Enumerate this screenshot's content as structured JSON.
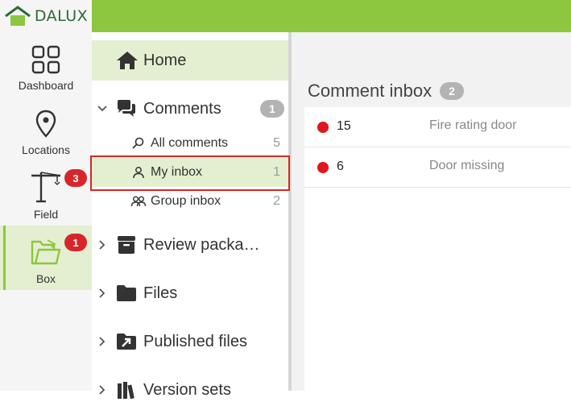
{
  "brand": {
    "name": "DALUX",
    "accent": "#8dc63f",
    "logo_icon": "house-icon"
  },
  "rail": [
    {
      "label": "Dashboard",
      "icon": "grid-icon",
      "badge": null
    },
    {
      "label": "Locations",
      "icon": "map-pin-icon",
      "badge": null
    },
    {
      "label": "Field",
      "icon": "crane-icon",
      "badge": "3"
    },
    {
      "label": "Box",
      "icon": "open-folder-icon",
      "badge": "1"
    }
  ],
  "tree": {
    "home": {
      "label": "Home",
      "icon": "home-icon"
    },
    "comments": {
      "label": "Comments",
      "icon": "chat-icon",
      "count": "1"
    },
    "subs": [
      {
        "label": "All comments",
        "icon": "search-icon",
        "count": "5"
      },
      {
        "label": "My inbox",
        "icon": "person-icon",
        "count": "1"
      },
      {
        "label": "Group inbox",
        "icon": "group-icon",
        "count": "2"
      }
    ],
    "folders": [
      {
        "label": "Review packa…",
        "icon": "archive-icon"
      },
      {
        "label": "Files",
        "icon": "folder-icon"
      },
      {
        "label": "Published files",
        "icon": "published-icon"
      },
      {
        "label": "Version sets",
        "icon": "version-sets-icon"
      }
    ]
  },
  "main": {
    "title": "Comment inbox",
    "count": "2",
    "rows": [
      {
        "id": "15",
        "title": "Fire rating door"
      },
      {
        "id": "6",
        "title": "Door missing"
      }
    ]
  }
}
